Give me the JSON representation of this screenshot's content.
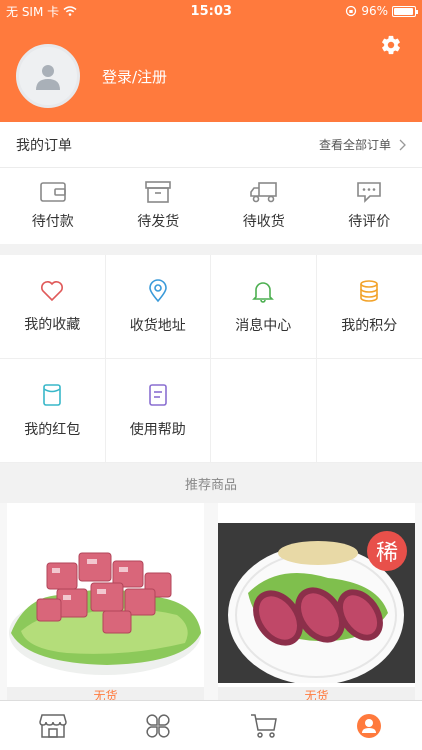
{
  "status": {
    "carrier": "无 SIM 卡",
    "time": "15:03",
    "battery": "96%",
    "battery_level": 0.96
  },
  "profile": {
    "login_label": "登录/注册"
  },
  "orders": {
    "title": "我的订单",
    "view_all": "查看全部订单",
    "items": [
      {
        "label": "待付款",
        "icon": "wallet-icon"
      },
      {
        "label": "待发货",
        "icon": "box-icon"
      },
      {
        "label": "待收货",
        "icon": "truck-icon"
      },
      {
        "label": "待评价",
        "icon": "comment-icon"
      }
    ]
  },
  "services": [
    {
      "label": "我的收藏",
      "icon": "heart-icon",
      "color": "#e05a5a"
    },
    {
      "label": "收货地址",
      "icon": "location-icon",
      "color": "#3a9ad9"
    },
    {
      "label": "消息中心",
      "icon": "bell-icon",
      "color": "#4caf50"
    },
    {
      "label": "我的积分",
      "icon": "coins-icon",
      "color": "#f2a32b"
    },
    {
      "label": "我的红包",
      "icon": "redpacket-icon",
      "color": "#38b7c9"
    },
    {
      "label": "使用帮助",
      "icon": "help-doc-icon",
      "color": "#8a6fd1"
    }
  ],
  "recommend": {
    "title": "推荐商品",
    "products": [
      {
        "image": "product-meat-cubes-image",
        "stock": "无货"
      },
      {
        "image": "product-sausage-image",
        "badge": "稀",
        "stock": "无货"
      }
    ]
  },
  "tabbar": [
    {
      "icon": "shop-icon"
    },
    {
      "icon": "category-icon"
    },
    {
      "icon": "cart-icon"
    },
    {
      "icon": "profile-icon",
      "active": true,
      "color": "#ff7a3d"
    }
  ],
  "colors": {
    "accent": "#ff7a3d",
    "background": "#f2f2f2"
  }
}
